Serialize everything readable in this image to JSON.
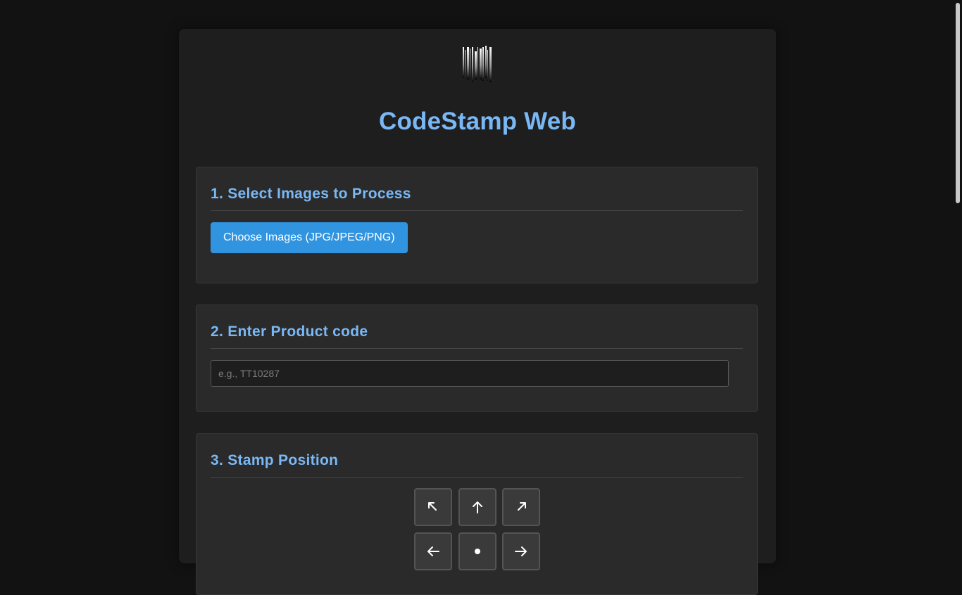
{
  "app": {
    "title": "CodeStamp Web",
    "accent_color": "#7ab8f5",
    "button_color": "#3194e0",
    "logo_icon": "barcode-stamp-logo"
  },
  "sections": {
    "select_images": {
      "heading": "1. Select Images to Process",
      "button_label": "Choose Images (JPG/JPEG/PNG)"
    },
    "product_code": {
      "heading": "2. Enter Product code",
      "input_value": "",
      "input_placeholder": "e.g., TT10287"
    },
    "stamp_position": {
      "heading": "3. Stamp Position",
      "buttons": [
        {
          "icon": "arrow-up-left-icon"
        },
        {
          "icon": "arrow-up-icon"
        },
        {
          "icon": "arrow-up-right-icon"
        },
        {
          "icon": "arrow-left-icon"
        },
        {
          "icon": "center-icon"
        },
        {
          "icon": "arrow-right-icon"
        }
      ]
    }
  }
}
